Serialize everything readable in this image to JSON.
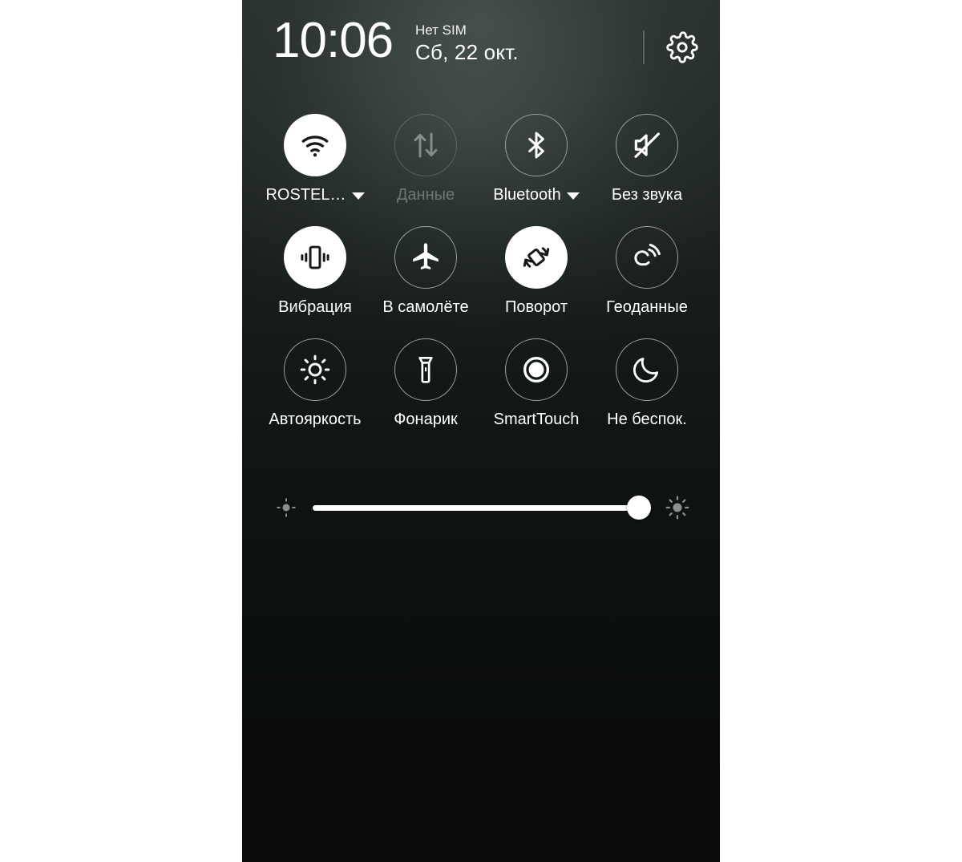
{
  "header": {
    "clock": "10:06",
    "sim_status": "Нет SIM",
    "date": "Сб, 22 окт.",
    "settings_icon": "gear-icon"
  },
  "tiles": [
    {
      "label": "ROSTEL…",
      "icon": "wifi-icon",
      "state": "on",
      "caret": true
    },
    {
      "label": "Данные",
      "icon": "data-arrows-icon",
      "state": "disabled",
      "caret": false
    },
    {
      "label": "Bluetooth",
      "icon": "bluetooth-icon",
      "state": "off",
      "caret": true
    },
    {
      "label": "Без звука",
      "icon": "volume-mute-icon",
      "state": "off",
      "caret": false
    },
    {
      "label": "Вибрация",
      "icon": "vibration-icon",
      "state": "on",
      "caret": false
    },
    {
      "label": "В самолёте",
      "icon": "airplane-icon",
      "state": "off",
      "caret": false
    },
    {
      "label": "Поворот",
      "icon": "rotation-icon",
      "state": "on",
      "caret": false
    },
    {
      "label": "Геоданные",
      "icon": "location-icon",
      "state": "off",
      "caret": false
    },
    {
      "label": "Автояркость",
      "icon": "brightness-auto-icon",
      "state": "off",
      "caret": false
    },
    {
      "label": "Фонарик",
      "icon": "flashlight-icon",
      "state": "off",
      "caret": false
    },
    {
      "label": "SmartTouch",
      "icon": "smarttouch-icon",
      "state": "off",
      "caret": false
    },
    {
      "label": "Не беспок.",
      "icon": "moon-icon",
      "state": "off",
      "caret": false
    }
  ],
  "brightness": {
    "value_percent": 97,
    "low_icon": "brightness-low-icon",
    "high_icon": "brightness-high-icon"
  },
  "colors": {
    "panel_top": "#262d2b",
    "panel_bottom": "#090c0b",
    "active_tile": "#ffffff",
    "inactive_outline": "#9aa19e",
    "text": "#ffffff",
    "page_background": "#ffffff"
  }
}
